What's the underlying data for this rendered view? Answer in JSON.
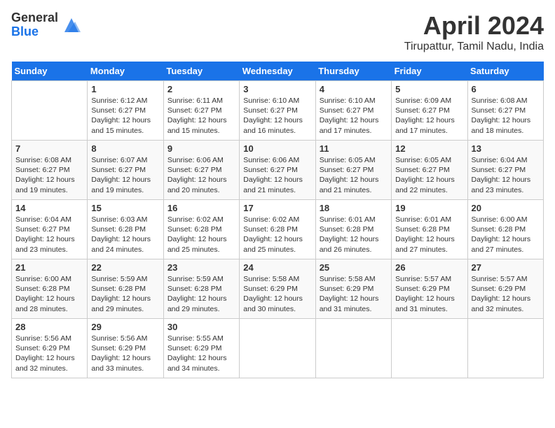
{
  "header": {
    "logo_general": "General",
    "logo_blue": "Blue",
    "title": "April 2024",
    "subtitle": "Tirupattur, Tamil Nadu, India"
  },
  "calendar": {
    "headers": [
      "Sunday",
      "Monday",
      "Tuesday",
      "Wednesday",
      "Thursday",
      "Friday",
      "Saturday"
    ],
    "weeks": [
      [
        {
          "day": "",
          "sunrise": "",
          "sunset": "",
          "daylight": "",
          "empty": true
        },
        {
          "day": "1",
          "sunrise": "Sunrise: 6:12 AM",
          "sunset": "Sunset: 6:27 PM",
          "daylight": "Daylight: 12 hours and 15 minutes."
        },
        {
          "day": "2",
          "sunrise": "Sunrise: 6:11 AM",
          "sunset": "Sunset: 6:27 PM",
          "daylight": "Daylight: 12 hours and 15 minutes."
        },
        {
          "day": "3",
          "sunrise": "Sunrise: 6:10 AM",
          "sunset": "Sunset: 6:27 PM",
          "daylight": "Daylight: 12 hours and 16 minutes."
        },
        {
          "day": "4",
          "sunrise": "Sunrise: 6:10 AM",
          "sunset": "Sunset: 6:27 PM",
          "daylight": "Daylight: 12 hours and 17 minutes."
        },
        {
          "day": "5",
          "sunrise": "Sunrise: 6:09 AM",
          "sunset": "Sunset: 6:27 PM",
          "daylight": "Daylight: 12 hours and 17 minutes."
        },
        {
          "day": "6",
          "sunrise": "Sunrise: 6:08 AM",
          "sunset": "Sunset: 6:27 PM",
          "daylight": "Daylight: 12 hours and 18 minutes."
        }
      ],
      [
        {
          "day": "7",
          "sunrise": "Sunrise: 6:08 AM",
          "sunset": "Sunset: 6:27 PM",
          "daylight": "Daylight: 12 hours and 19 minutes."
        },
        {
          "day": "8",
          "sunrise": "Sunrise: 6:07 AM",
          "sunset": "Sunset: 6:27 PM",
          "daylight": "Daylight: 12 hours and 19 minutes."
        },
        {
          "day": "9",
          "sunrise": "Sunrise: 6:06 AM",
          "sunset": "Sunset: 6:27 PM",
          "daylight": "Daylight: 12 hours and 20 minutes."
        },
        {
          "day": "10",
          "sunrise": "Sunrise: 6:06 AM",
          "sunset": "Sunset: 6:27 PM",
          "daylight": "Daylight: 12 hours and 21 minutes."
        },
        {
          "day": "11",
          "sunrise": "Sunrise: 6:05 AM",
          "sunset": "Sunset: 6:27 PM",
          "daylight": "Daylight: 12 hours and 21 minutes."
        },
        {
          "day": "12",
          "sunrise": "Sunrise: 6:05 AM",
          "sunset": "Sunset: 6:27 PM",
          "daylight": "Daylight: 12 hours and 22 minutes."
        },
        {
          "day": "13",
          "sunrise": "Sunrise: 6:04 AM",
          "sunset": "Sunset: 6:27 PM",
          "daylight": "Daylight: 12 hours and 23 minutes."
        }
      ],
      [
        {
          "day": "14",
          "sunrise": "Sunrise: 6:04 AM",
          "sunset": "Sunset: 6:27 PM",
          "daylight": "Daylight: 12 hours and 23 minutes."
        },
        {
          "day": "15",
          "sunrise": "Sunrise: 6:03 AM",
          "sunset": "Sunset: 6:28 PM",
          "daylight": "Daylight: 12 hours and 24 minutes."
        },
        {
          "day": "16",
          "sunrise": "Sunrise: 6:02 AM",
          "sunset": "Sunset: 6:28 PM",
          "daylight": "Daylight: 12 hours and 25 minutes."
        },
        {
          "day": "17",
          "sunrise": "Sunrise: 6:02 AM",
          "sunset": "Sunset: 6:28 PM",
          "daylight": "Daylight: 12 hours and 25 minutes."
        },
        {
          "day": "18",
          "sunrise": "Sunrise: 6:01 AM",
          "sunset": "Sunset: 6:28 PM",
          "daylight": "Daylight: 12 hours and 26 minutes."
        },
        {
          "day": "19",
          "sunrise": "Sunrise: 6:01 AM",
          "sunset": "Sunset: 6:28 PM",
          "daylight": "Daylight: 12 hours and 27 minutes."
        },
        {
          "day": "20",
          "sunrise": "Sunrise: 6:00 AM",
          "sunset": "Sunset: 6:28 PM",
          "daylight": "Daylight: 12 hours and 27 minutes."
        }
      ],
      [
        {
          "day": "21",
          "sunrise": "Sunrise: 6:00 AM",
          "sunset": "Sunset: 6:28 PM",
          "daylight": "Daylight: 12 hours and 28 minutes."
        },
        {
          "day": "22",
          "sunrise": "Sunrise: 5:59 AM",
          "sunset": "Sunset: 6:28 PM",
          "daylight": "Daylight: 12 hours and 29 minutes."
        },
        {
          "day": "23",
          "sunrise": "Sunrise: 5:59 AM",
          "sunset": "Sunset: 6:28 PM",
          "daylight": "Daylight: 12 hours and 29 minutes."
        },
        {
          "day": "24",
          "sunrise": "Sunrise: 5:58 AM",
          "sunset": "Sunset: 6:29 PM",
          "daylight": "Daylight: 12 hours and 30 minutes."
        },
        {
          "day": "25",
          "sunrise": "Sunrise: 5:58 AM",
          "sunset": "Sunset: 6:29 PM",
          "daylight": "Daylight: 12 hours and 31 minutes."
        },
        {
          "day": "26",
          "sunrise": "Sunrise: 5:57 AM",
          "sunset": "Sunset: 6:29 PM",
          "daylight": "Daylight: 12 hours and 31 minutes."
        },
        {
          "day": "27",
          "sunrise": "Sunrise: 5:57 AM",
          "sunset": "Sunset: 6:29 PM",
          "daylight": "Daylight: 12 hours and 32 minutes."
        }
      ],
      [
        {
          "day": "28",
          "sunrise": "Sunrise: 5:56 AM",
          "sunset": "Sunset: 6:29 PM",
          "daylight": "Daylight: 12 hours and 32 minutes."
        },
        {
          "day": "29",
          "sunrise": "Sunrise: 5:56 AM",
          "sunset": "Sunset: 6:29 PM",
          "daylight": "Daylight: 12 hours and 33 minutes."
        },
        {
          "day": "30",
          "sunrise": "Sunrise: 5:55 AM",
          "sunset": "Sunset: 6:29 PM",
          "daylight": "Daylight: 12 hours and 34 minutes."
        },
        {
          "day": "",
          "sunrise": "",
          "sunset": "",
          "daylight": "",
          "empty": true
        },
        {
          "day": "",
          "sunrise": "",
          "sunset": "",
          "daylight": "",
          "empty": true
        },
        {
          "day": "",
          "sunrise": "",
          "sunset": "",
          "daylight": "",
          "empty": true
        },
        {
          "day": "",
          "sunrise": "",
          "sunset": "",
          "daylight": "",
          "empty": true
        }
      ]
    ]
  }
}
